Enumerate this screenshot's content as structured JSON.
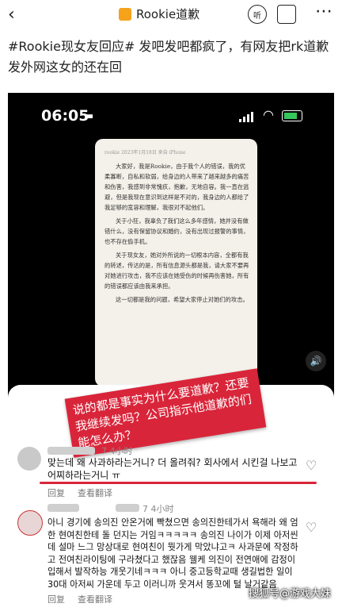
{
  "header": {
    "back_glyph": "‹",
    "title": "Rookie道歉",
    "listen_label": "听",
    "more_glyph": "⋯"
  },
  "post": {
    "caption": "#Rookie现女友回应# 发吧发吧都疯了，有网友把rk道歉发外网这女的还在回"
  },
  "phone": {
    "time": "06:05",
    "letter_meta": "rookie  2023年1月18日  来自 iPhone",
    "letter_paragraphs": [
      "大家好，我是Rookie，由于我个人的错误，我的优柔寡断，自私和软弱，给身边的人带来了越来越多的痛苦和伤害，我感到非常愧疚，抱歉，无地自容。我一直在逃避，但是我现在意识到这样是不对的，我身边的人都给了我足够的宽容和理解，我很对不起他们。",
      "关于小狂，我辜负了我们这么多年感情，她并没有做错什么，没有保留协议和婚约，没有出现过报警的事情，也不存在偷手机。",
      "关于现女友，她对外所说的一切根本内容，全都有我的转述，传达的是，所有信息源头都是我，请大家不要再对她进行攻击，我不应该在她受伤的时候再伤害她，所有的错误都应该由我来承担。",
      "这一切都是我的问题，希望大家停止对她们的攻击。"
    ],
    "sound_glyph": "🔊",
    "stamp_text": "说的都是事实为什么要道歉？还要我继续发吗？公司指示他道歉的们能怎么办？",
    "comments": [
      {
        "time": "7 4小时",
        "text": "맞는데 왜 사과하라는거니? 더 올려줘? 회사에서 시킨걸 나보고 어찌하라는거니 ㅠ",
        "reply_label": "回复",
        "translate_label": "查看翻译"
      },
      {
        "time": "7 4小时",
        "text": "아니 경기에 송의진 안온거에 빡쳤으면 송의진한테가서 욕해라 왜 엄한 현여친한테 돌 던지는 거임ㅋㅋㅋㅋㅋ 송의진 나이가 이제 아저씬데 설마 느그 망상대로 현여친이 뭣가게 막았냐고ㅋ 사과문에 작정하고 전여친라이팅에 구라쳤다고 했잖음 웰케 의진이 전연애에 감정이입해서 발작하능 개웃기네ㅋㅋㅋ 아니 중고등학교때 생길법한 일이 30대 아저씨 가운데 두고 이러니까 웃겨서 똥꼬에 털 날거같음",
        "reply_label": "回复",
        "translate_label": "查看翻译"
      }
    ],
    "watermark": "搜狐号@游戏大妹"
  },
  "colors": {
    "stamp_red": "#d9253a",
    "brand_orange": "#f6a21b",
    "battery_green": "#35c759"
  }
}
